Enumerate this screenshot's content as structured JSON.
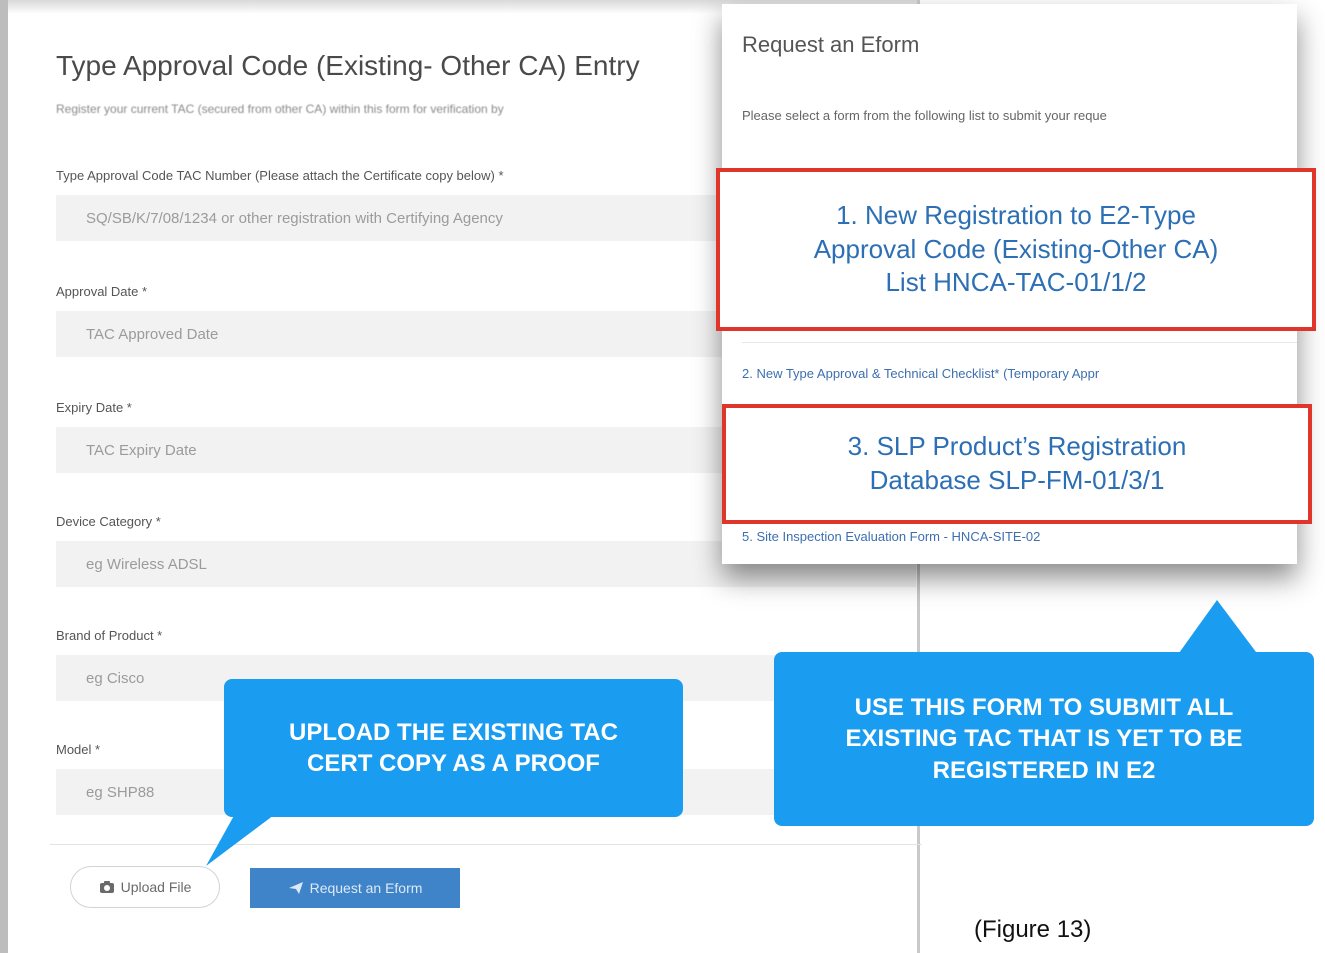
{
  "form": {
    "title": "Type Approval Code (Existing- Other CA) Entry",
    "subtitle": "Register your current TAC (secured from other CA) within this form for verification by",
    "fields": [
      {
        "label": "Type Approval Code TAC Number (Please attach the Certificate copy below) *",
        "placeholder": "SQ/SB/K/7/08/1234 or other registration with Certifying Agency"
      },
      {
        "label": "Approval Date *",
        "placeholder": "TAC Approved Date"
      },
      {
        "label": "Expiry Date *",
        "placeholder": "TAC Expiry Date"
      },
      {
        "label": "Device Category *",
        "placeholder": "eg Wireless ADSL"
      },
      {
        "label": "Brand of Product *",
        "placeholder": "eg Cisco"
      },
      {
        "label": "Model *",
        "placeholder": "eg SHP88"
      }
    ],
    "upload_label": "Upload File",
    "request_label": "Request an Eform"
  },
  "eform": {
    "title": "Request an Eform",
    "description": "Please select a form from the following list to submit your reque",
    "items": [
      {
        "label": "1. New Registration to E2-Type\nApproval Code (Existing-Other CA)\nList HNCA-TAC-01/1/2"
      },
      {
        "label": "2. New Type Approval & Technical Checklist* (Temporary Appr"
      },
      {
        "label": "3. SLP Product’s Registration\nDatabase SLP-FM-01/3/1"
      },
      {
        "label": "5. Site Inspection Evaluation Form - HNCA-SITE-02"
      }
    ]
  },
  "callouts": {
    "upload": "UPLOAD THE EXISTING TAC\nCERT COPY AS A PROOF",
    "form": "USE THIS FORM TO SUBMIT ALL\nEXISTING TAC THAT IS YET TO BE\nREGISTERED IN E2"
  },
  "caption": "(Figure 13)",
  "colors": {
    "highlight_border": "#e0352b",
    "highlight_text": "#2d6fb4",
    "callout_bg": "#1a9cf0",
    "request_button": "#3f84c8"
  },
  "icons": {
    "upload": "camera-icon",
    "request": "paper-plane-icon"
  }
}
